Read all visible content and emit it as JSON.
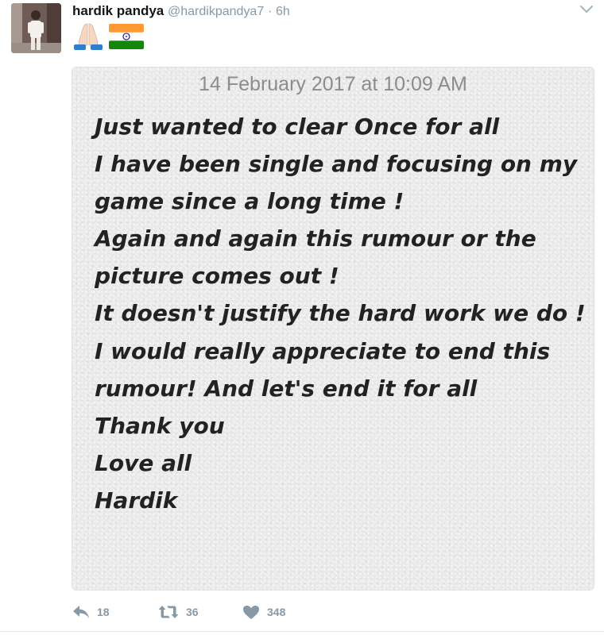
{
  "tweet": {
    "author_name": "hardik pandya",
    "author_handle": "@hardikpandya7",
    "separator": "·",
    "time_ago": "6h",
    "emojis": [
      "folded-hands",
      "india-flag"
    ]
  },
  "note": {
    "date": "14 February 2017 at 10:09 AM",
    "lines": [
      "Just wanted to clear Once for all",
      "I have been single and focusing on my",
      "game since a long time !",
      "Again and again this rumour or the",
      "picture comes out !",
      "It doesn't justify the hard work we do !",
      "I would really appreciate to end this",
      "rumour! And let's end it for all",
      "Thank you",
      "Love all",
      "Hardik"
    ]
  },
  "actions": {
    "reply_count": "18",
    "retweet_count": "36",
    "like_count": "348"
  },
  "colors": {
    "muted": "#8899a6",
    "name": "#14171a",
    "note_text": "#222222",
    "note_date": "#8c8c8c",
    "flag_saffron": "#ff9933",
    "flag_green": "#138808",
    "flag_chakra": "#000080"
  }
}
